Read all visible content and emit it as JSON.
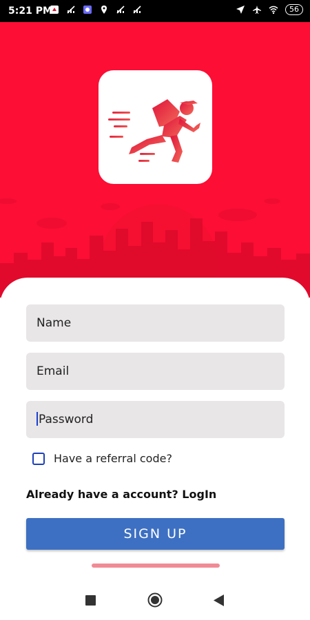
{
  "status_bar": {
    "time": "5:21 PM",
    "battery": "56",
    "left_icons": [
      "notification-app-icon",
      "sim-no-signal-icon",
      "app-badge-icon",
      "location-app-icon",
      "sim-no-signal-icon",
      "sim-no-signal-icon"
    ],
    "right_icons": [
      "location-arrow-icon",
      "airplane-icon",
      "wifi-icon",
      "battery-icon"
    ]
  },
  "hero": {
    "background_color": "#fc0e35",
    "logo": "delivery-runner-logo"
  },
  "form": {
    "name_placeholder": "Name",
    "email_placeholder": "Email",
    "password_placeholder": "Password",
    "referral_label": "Have a referral code?",
    "login_prompt": "Already have a account? LogIn",
    "signup_label": "SIGN UP"
  },
  "nav_bar": {
    "buttons": [
      "recents-square-icon",
      "home-circle-icon",
      "back-triangle-icon"
    ]
  }
}
